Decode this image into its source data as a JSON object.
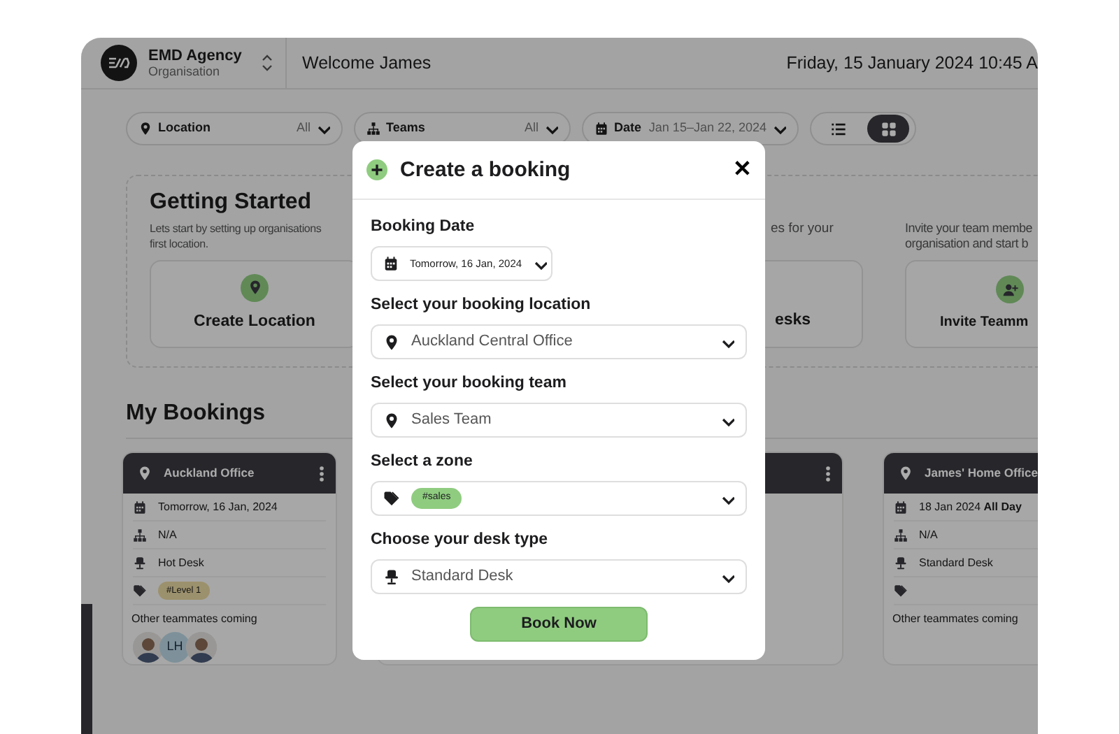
{
  "app_header": {
    "org_name": "EMD Agency",
    "org_subtitle": "Organisation",
    "welcome": "Welcome James",
    "datetime": "Friday, 15 January 2024 10:45 A"
  },
  "filters": [
    {
      "label": "Location",
      "value": "All"
    },
    {
      "label": "Teams",
      "value": "All"
    },
    {
      "label": "Date",
      "value": "Jan 15–Jan 22, 2024"
    }
  ],
  "view_toggle": [
    {
      "kind": "list",
      "selected": false
    },
    {
      "kind": "grid",
      "selected": true
    }
  ],
  "getting_started": {
    "title": "Getting Started",
    "columns": [
      {
        "description_lines": [
          "Lets start by setting up organisations",
          "first location."
        ],
        "action": "Create Location"
      },
      {
        "description_lines": [
          "es for your"
        ],
        "action": "esks"
      },
      {
        "description_lines": [
          "Invite your team membe",
          "organisation and start b"
        ],
        "action": "Invite Teamm"
      }
    ]
  },
  "my_bookings": {
    "title": "My Bookings",
    "cards": [
      {
        "title": "Auckland Office",
        "menu": true,
        "date": "Tomorrow, 16 Jan, 2024",
        "team": "N/A",
        "desk": "Hot Desk",
        "tags": [
          {
            "label": "#Level 1"
          }
        ],
        "teammates_label": "Other teammates coming",
        "teammates": [
          {
            "kind": "photo"
          },
          {
            "kind": "initials",
            "initials": "LH"
          },
          {
            "kind": "photo"
          }
        ]
      },
      {
        "menu": true
      },
      {
        "title": "James' Home Office",
        "date": "18 Jan 2024 **All Day**",
        "team": "N/A",
        "desk": "Standard Desk",
        "teammates_label": "Other teammates coming"
      }
    ]
  },
  "modal": {
    "title": "Create a booking",
    "close": "✕",
    "fields": [
      {
        "kind": "date",
        "label": "Booking Date",
        "value": "Tomorrow, 16 Jan, 2024"
      },
      {
        "kind": "select",
        "label": "Select your booking location",
        "value": "Auckland Central Office"
      },
      {
        "kind": "select",
        "label": "Select your booking team",
        "value": "Sales Team"
      },
      {
        "kind": "tags",
        "label": "Select a zone",
        "tags": [
          {
            "label": "#sales"
          }
        ]
      },
      {
        "kind": "select",
        "label": "Choose your desk type",
        "value": "Standard Desk"
      }
    ],
    "submit": "Book Now"
  }
}
